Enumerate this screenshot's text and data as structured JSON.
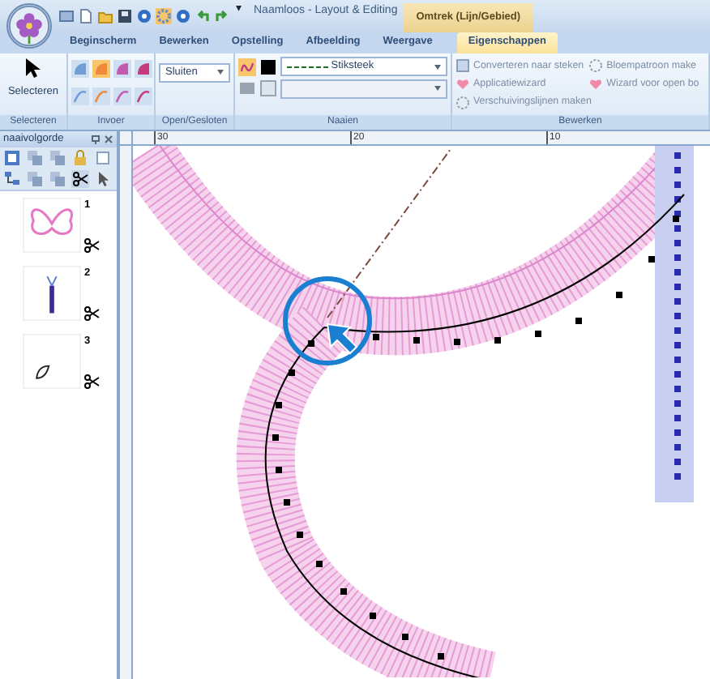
{
  "window": {
    "title": "Naamloos - Layout & Editing",
    "context_tab": "Omtrek (Lijn/Gebied)",
    "menu_arrow": "▾"
  },
  "tabs": [
    {
      "label": "Beginscherm",
      "selected": false
    },
    {
      "label": "Bewerken",
      "selected": false
    },
    {
      "label": "Opstelling",
      "selected": false
    },
    {
      "label": "Afbeelding",
      "selected": false
    },
    {
      "label": "Weergave",
      "selected": false
    },
    {
      "label": "Eigenschappen",
      "selected": true
    }
  ],
  "ribbon": [
    {
      "kind": "select",
      "label": "Selecteren",
      "button": "Selecteren"
    },
    {
      "kind": "tools",
      "label": "Invoer",
      "tools": [
        {
          "selected": false
        },
        {
          "selected": true
        },
        {
          "selected": false
        },
        {
          "selected": false
        },
        {
          "selected": false
        },
        {
          "selected": false
        },
        {
          "selected": false
        },
        {
          "selected": false
        }
      ]
    },
    {
      "kind": "dropdown",
      "label": "Open/Gesloten",
      "value": "Sluiten"
    },
    {
      "kind": "sew",
      "label": "Naaien",
      "stitch": "Stiksteek"
    },
    {
      "kind": "commands",
      "label": "Bewerken",
      "commands": [
        {
          "label": "Converteren naar steken",
          "disabled": true
        },
        {
          "label": "Bloempatroon make",
          "disabled": true
        },
        {
          "label": "Applicatiewizard",
          "disabled": true
        },
        {
          "label": "Wizard voor open bo",
          "disabled": true
        },
        {
          "label": "Verschuivingslijnen maken",
          "disabled": true
        }
      ]
    }
  ],
  "panel": {
    "title": "naaivolgorde",
    "items": [
      {
        "number": "1",
        "kind": "butterfly"
      },
      {
        "number": "2",
        "kind": "stick"
      },
      {
        "number": "3",
        "kind": "leaf"
      }
    ]
  },
  "ruler": {
    "labels": [
      "30",
      "20",
      "10"
    ]
  }
}
